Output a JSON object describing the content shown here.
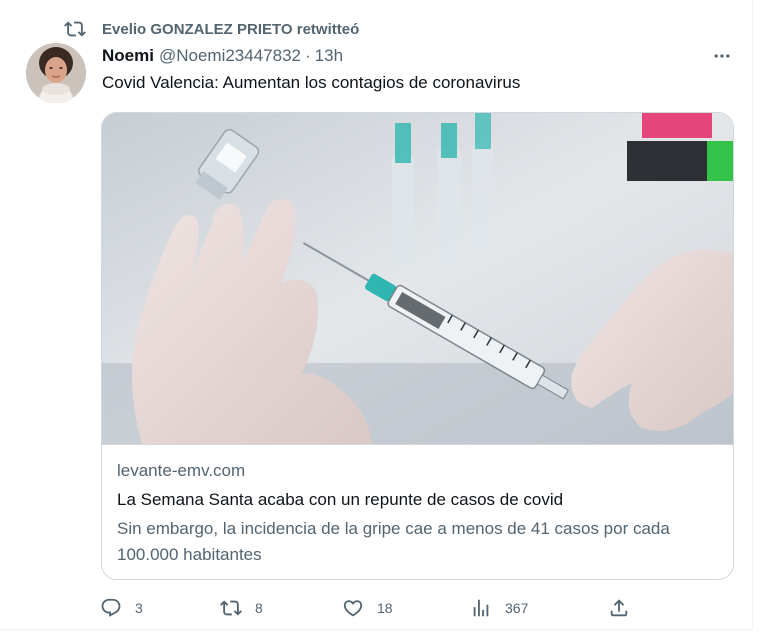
{
  "retweet": {
    "icon": "retweet-icon",
    "label": "Evelio GONZALEZ PRIETO retwitteó"
  },
  "author": {
    "name": "Noemi",
    "handle": "@Noemi23447832",
    "separator": "·",
    "time": "13h",
    "avatar": "avatar-photo"
  },
  "more_icon": "more-horizontal-icon",
  "tweet": {
    "text": "Covid Valencia: Aumentan los contagios de coronavirus"
  },
  "card": {
    "image": "vaccine-syringe-photo",
    "domain": "levante-emv.com",
    "title": "La Semana Santa acaba con un repunte de casos de covid",
    "description": "Sin embargo, la incidencia de la gripe cae a menos de 41 casos por cada 100.000 habitantes"
  },
  "actions": {
    "reply": {
      "icon": "reply-icon",
      "count": "3"
    },
    "retweet": {
      "icon": "retweet-icon",
      "count": "8"
    },
    "like": {
      "icon": "heart-icon",
      "count": "18"
    },
    "views": {
      "icon": "views-chart-icon",
      "count": "367"
    },
    "share": {
      "icon": "share-icon"
    }
  },
  "colors": {
    "text_primary": "#0f1419",
    "text_secondary": "#536471",
    "border": "#cfd9de"
  }
}
